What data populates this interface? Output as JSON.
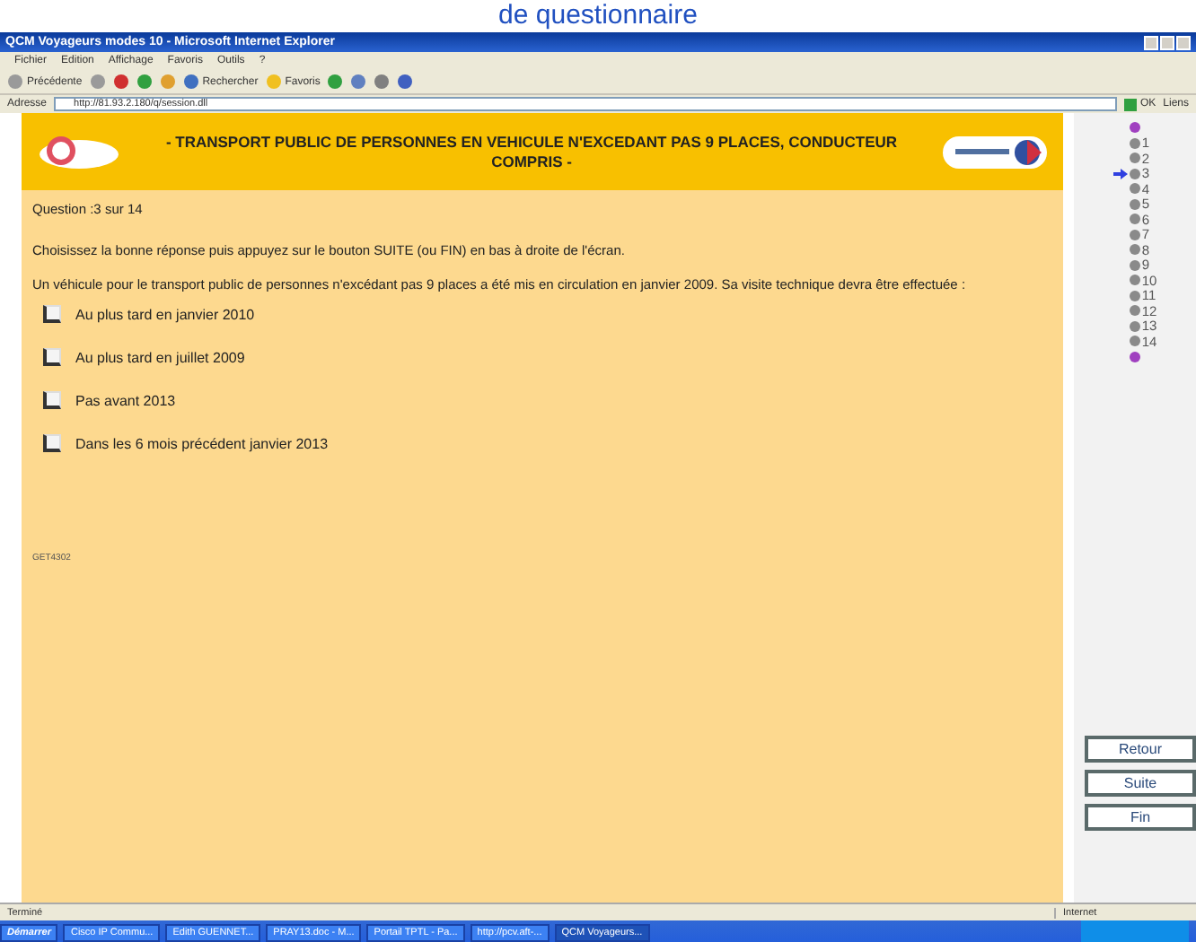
{
  "caption": "de questionnaire",
  "window": {
    "title": "QCM Voyageurs modes 10 - Microsoft Internet Explorer"
  },
  "menu": [
    "Fichier",
    "Edition",
    "Affichage",
    "Favoris",
    "Outils",
    "?"
  ],
  "toolbar": [
    {
      "kind": "back",
      "label": "Précédente"
    },
    {
      "kind": "forward"
    },
    {
      "kind": "stop"
    },
    {
      "kind": "refresh"
    },
    {
      "kind": "home"
    },
    {
      "kind": "search",
      "label": "Rechercher"
    },
    {
      "kind": "favorites",
      "label": "Favoris"
    },
    {
      "kind": "history"
    },
    {
      "kind": "mail"
    },
    {
      "kind": "print"
    },
    {
      "kind": "edit"
    }
  ],
  "address": {
    "label": "Adresse",
    "value": "http://81.93.2.180/q/session.dll",
    "go": "OK",
    "links": "Liens"
  },
  "header": {
    "title": "- TRANSPORT PUBLIC DE PERSONNES EN VEHICULE N'EXCEDANT PAS 9 PLACES, CONDUCTEUR COMPRIS -"
  },
  "question": {
    "counter": "Question :3 sur 14",
    "instruction": "Choisissez la bonne réponse puis appuyez sur le bouton SUITE (ou FIN) en bas à droite de l'écran.",
    "text": "Un véhicule pour le transport public de personnes n'excédant pas 9 places a été mis en circulation en janvier 2009. Sa visite technique devra être effectuée :",
    "answers": [
      {
        "label": "Au plus tard en janvier 2010",
        "checked": false
      },
      {
        "label": "Au plus tard en juillet 2009",
        "checked": false
      },
      {
        "label": "Pas avant 2013",
        "checked": false
      },
      {
        "label": "Dans les 6 mois précédent janvier 2013",
        "checked": false
      }
    ],
    "code": "GET4302"
  },
  "navigation": [
    {
      "label": "1",
      "selected": false
    },
    {
      "label": "2",
      "selected": false
    },
    {
      "label": "3",
      "selected": true
    },
    {
      "label": "4",
      "selected": false
    },
    {
      "label": "5",
      "selected": false
    },
    {
      "label": "6",
      "selected": false
    },
    {
      "label": "7",
      "selected": false
    },
    {
      "label": "8",
      "selected": false
    },
    {
      "label": "9",
      "selected": false
    },
    {
      "label": "10",
      "selected": false
    },
    {
      "label": "11",
      "selected": false
    },
    {
      "label": "12",
      "selected": false
    },
    {
      "label": "13",
      "selected": false
    },
    {
      "label": "14",
      "selected": false
    }
  ],
  "buttons": [
    "Retour",
    "Suite",
    "Fin"
  ],
  "status_bar": {
    "text": "Terminé",
    "zone": "Internet"
  },
  "taskbar": {
    "start": "Démarrer",
    "tasks": [
      {
        "label": "Cisco IP Commu...",
        "selected": false
      },
      {
        "label": "Edith GUENNET...",
        "selected": false
      },
      {
        "label": "PRAY13.doc - M...",
        "selected": false
      },
      {
        "label": "Portail TPTL - Pa...",
        "selected": false
      },
      {
        "label": "http://pcv.aft-...",
        "selected": false
      },
      {
        "label": "QCM Voyageurs...",
        "selected": true
      }
    ]
  }
}
